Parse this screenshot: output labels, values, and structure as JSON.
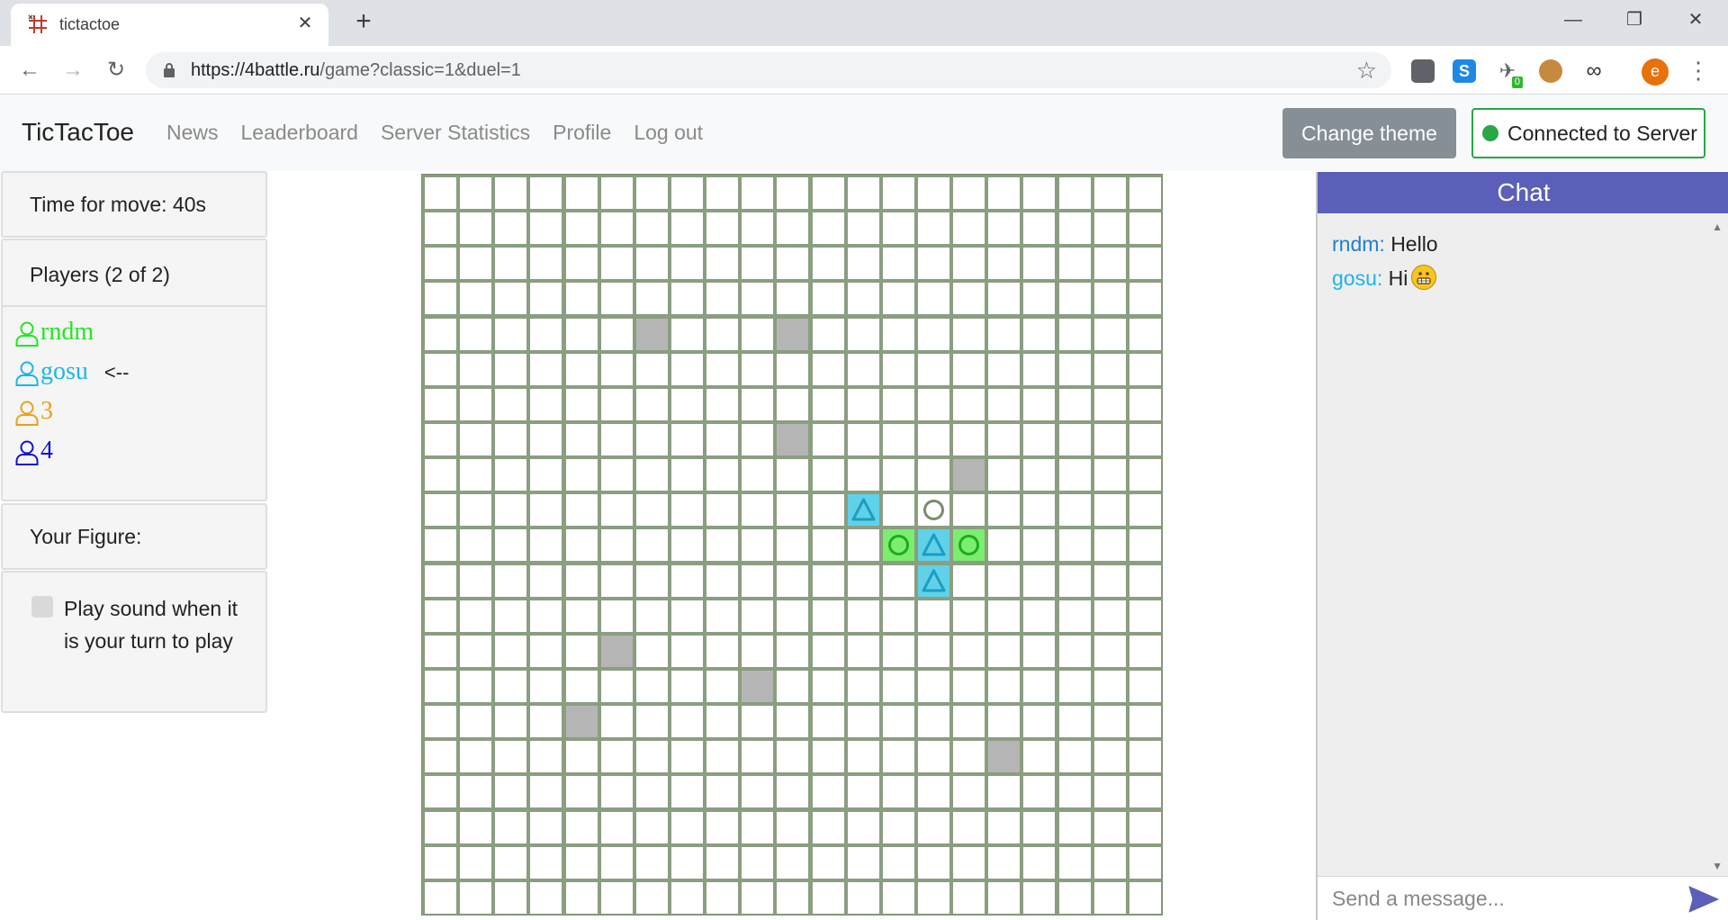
{
  "browser": {
    "tab_title": "tictactoe",
    "url_host": "https://4battle.ru",
    "url_path": "/game?classic=1&duel=1",
    "extension_badge": "0",
    "profile_initial": "e"
  },
  "navbar": {
    "brand": "TicTacToe",
    "links": [
      "News",
      "Leaderboard",
      "Server Statistics",
      "Profile",
      "Log out"
    ],
    "theme_button": "Change theme",
    "connection_status": "Connected to Server"
  },
  "left_panel": {
    "timer": "Time for move: 40s",
    "players_header": "Players (2 of 2)",
    "players": [
      {
        "name": "rndm",
        "color": "#1ee81e",
        "current_turn": false
      },
      {
        "name": "gosu",
        "color": "#1bb6e8",
        "current_turn": true
      },
      {
        "name": "3",
        "color": "#e9a11a",
        "current_turn": false
      },
      {
        "name": "4",
        "color": "#1313d6",
        "current_turn": false
      }
    ],
    "turn_marker": "<--",
    "your_figure_label": "Your Figure:",
    "sound_label": "Play sound when it is your turn to play",
    "sound_checked": false
  },
  "board": {
    "cols": 21,
    "rows": 21,
    "colors": {
      "grid": "#8a9e80",
      "blocked": "#b5b5b5",
      "triangle_bg": "#61d1e8",
      "circle_bg": "#7bee6f",
      "triangle": "#1a9ec2",
      "circle": "#1faa1f",
      "empty_circle": "#7a8b6e"
    },
    "blocked": [
      [
        6,
        4
      ],
      [
        10,
        4
      ],
      [
        10,
        7
      ],
      [
        15,
        8
      ],
      [
        5,
        13
      ],
      [
        9,
        14
      ],
      [
        4,
        15
      ],
      [
        16,
        16
      ]
    ],
    "pieces": [
      {
        "col": 12,
        "row": 9,
        "shape": "triangle",
        "highlight": true
      },
      {
        "col": 14,
        "row": 9,
        "shape": "circle",
        "highlight": false
      },
      {
        "col": 13,
        "row": 10,
        "shape": "circle",
        "highlight": true
      },
      {
        "col": 14,
        "row": 10,
        "shape": "triangle",
        "highlight": true
      },
      {
        "col": 15,
        "row": 10,
        "shape": "circle",
        "highlight": true
      },
      {
        "col": 14,
        "row": 11,
        "shape": "triangle",
        "highlight": true
      }
    ]
  },
  "chat": {
    "title": "Chat",
    "messages": [
      {
        "author": "rndm",
        "author_color": "#1e7fd0",
        "text": "Hello",
        "emoji": false
      },
      {
        "author": "gosu",
        "author_color": "#1bb6e8",
        "text": "Hi",
        "emoji": true
      }
    ],
    "input_placeholder": "Send a message..."
  }
}
